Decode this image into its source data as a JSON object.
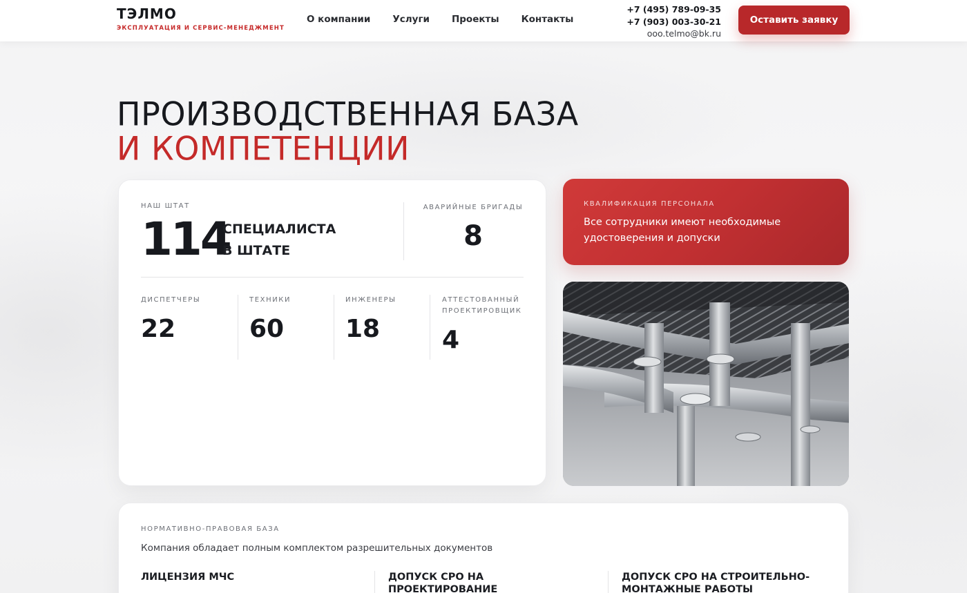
{
  "header": {
    "logo_name": "ТЭЛМО",
    "logo_tagline": "ЭКСПЛУАТАЦИЯ И СЕРВИС-МЕНЕДЖМЕНТ",
    "nav": [
      "О компании",
      "Услуги",
      "Проекты",
      "Контакты"
    ],
    "phone1": "+7 (495) 789-09-35",
    "phone2": "+7 (903) 003-30-21",
    "email": "ooo.telmo@bk.ru",
    "cta_label": "Оставить заявку"
  },
  "hero": {
    "title_line1": "ПРОИЗВОДСТВЕННАЯ БАЗА",
    "title_line2": "И КОМПЕТЕНЦИИ"
  },
  "staff": {
    "label": "НАШ ШТАТ",
    "total": "114",
    "caption_line1": "СПЕЦИАЛИСТА",
    "caption_line2": "В ШТАТЕ",
    "brigades_label": "АВАРИЙНЫЕ БРИГАДЫ",
    "brigades_value": "8",
    "roles": [
      {
        "label": "ДИСПЕТЧЕРЫ",
        "value": "22"
      },
      {
        "label": "ТЕХНИКИ",
        "value": "60"
      },
      {
        "label": "ИНЖЕНЕРЫ",
        "value": "18"
      },
      {
        "label": "АТТЕСТОВАННЫЙ ПРОЕКТИРОВЩИК",
        "value": "4"
      }
    ]
  },
  "qualification": {
    "label": "КВАЛИФИКАЦИЯ ПЕРСОНАЛА",
    "text": "Все сотрудники имеют необходимые удостоверения и допуски"
  },
  "legal": {
    "label": "НОРМАТИВНО-ПРАВОВАЯ БАЗА",
    "description": "Компания обладает полным комплектом разрешительных документов",
    "documents": [
      "ЛИЦЕНЗИЯ МЧС",
      "ДОПУСК СРО НА ПРОЕКТИРОВАНИЕ",
      "ДОПУСК СРО НА СТРОИТЕЛЬНО-МОНТАЖНЫЕ РАБОТЫ"
    ]
  },
  "colors": {
    "accent": "#c42a29",
    "dark_text": "#17191e"
  }
}
